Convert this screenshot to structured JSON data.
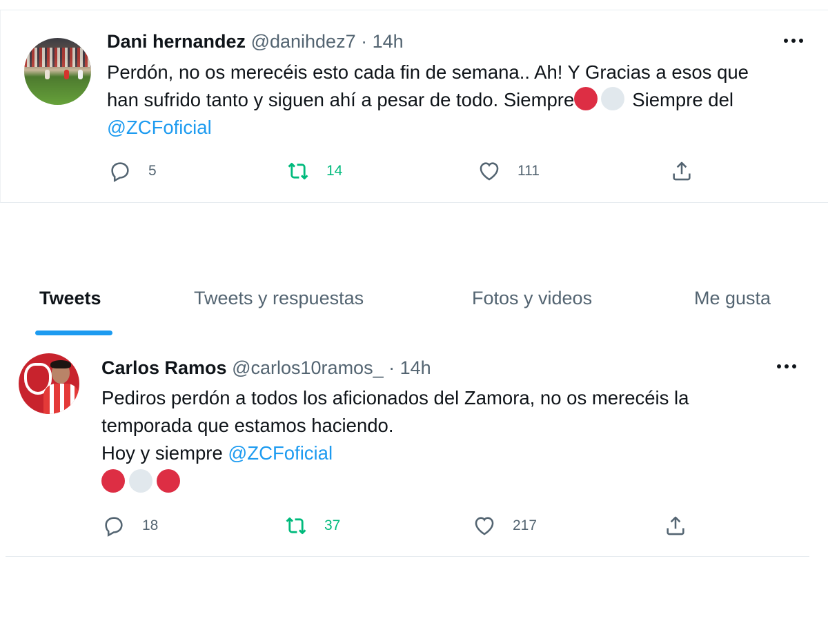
{
  "tweets": [
    {
      "author_name": "Dani hernandez",
      "handle": "@danihdez7",
      "separator": "·",
      "time": "14h",
      "lines": [
        "Perdón, no os merecéis esto cada fin de semana.. Ah! Y Gracias a esos que",
        "han sufrido tanto y siguen ahí a pesar de todo. Siempre",
        "Siempre del"
      ],
      "mention": "@ZCFoficial",
      "replies": "5",
      "retweets": "14",
      "likes": "111"
    },
    {
      "author_name": "Carlos Ramos",
      "handle": "@carlos10ramos_",
      "separator": "·",
      "time": "14h",
      "lines": [
        "Pediros perdón a todos los aficionados del Zamora, no os merecéis la",
        "temporada que estamos haciendo.",
        "Hoy y siempre"
      ],
      "mention": "@ZCFoficial",
      "replies": "18",
      "retweets": "37",
      "likes": "217"
    }
  ],
  "tabs": [
    {
      "label": "Tweets",
      "active": true
    },
    {
      "label": "Tweets y respuestas",
      "active": false
    },
    {
      "label": "Fotos y videos",
      "active": false
    },
    {
      "label": "Me gusta",
      "active": false
    }
  ],
  "icons": {
    "reply": "reply-icon",
    "retweet": "retweet-icon",
    "like": "heart-icon",
    "share": "share-icon",
    "more": "more-icon",
    "heart_emoji_red": "red-circle-emoji",
    "heart_emoji_white": "white-circle-emoji"
  },
  "colors": {
    "accent": "#1d9bf0",
    "retweet": "#00ba7c",
    "secondary_text": "#536471",
    "red_circle": "#dd2e44",
    "white_circle": "#e1e8ed"
  }
}
